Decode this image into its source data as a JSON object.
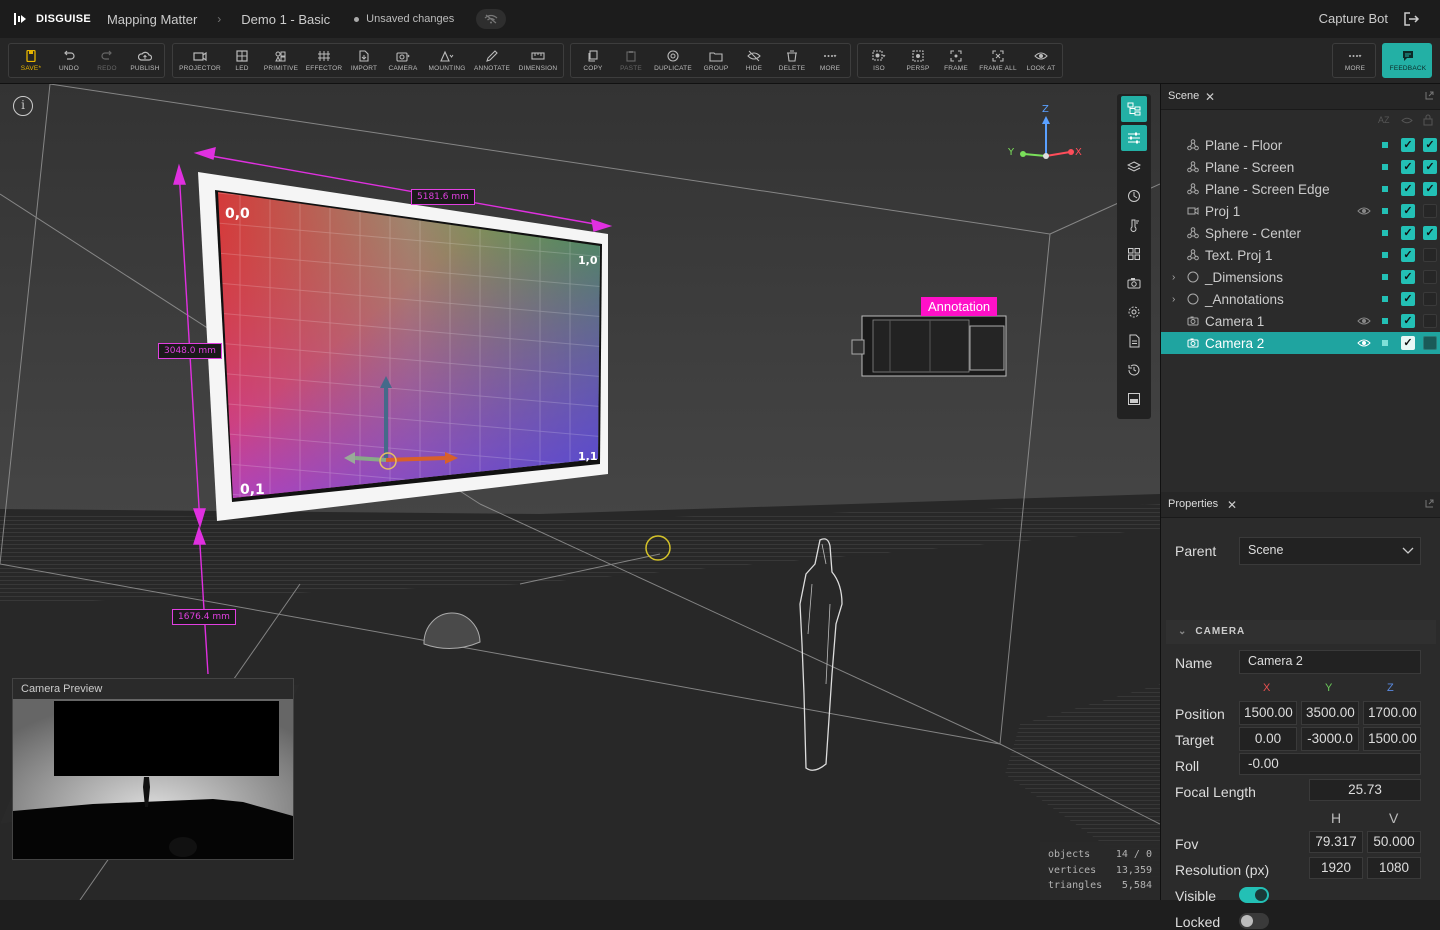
{
  "app": {
    "brand": "DISGUISE",
    "project": "Mapping Matter",
    "file": "Demo 1 - Basic",
    "status": "Unsaved changes",
    "user": "Capture Bot"
  },
  "toolbar": {
    "edit": [
      "SAVE*",
      "UNDO",
      "REDO",
      "PUBLISH"
    ],
    "create": [
      "PROJECTOR",
      "LED",
      "PRIMITIVE",
      "EFFECTOR",
      "IMPORT",
      "CAMERA",
      "MOUNTING",
      "ANNOTATE",
      "DIMENSION"
    ],
    "modify": [
      "COPY",
      "PASTE",
      "DUPLICATE",
      "GROUP",
      "HIDE",
      "DELETE",
      "MORE"
    ],
    "view": [
      "ISO",
      "PERSP",
      "FRAME",
      "FRAME ALL",
      "LOOK AT"
    ],
    "right": [
      "MORE",
      "FEEDBACK"
    ]
  },
  "viewport": {
    "dimensions": [
      "5181.6 mm",
      "3048.0 mm",
      "1676.4 mm"
    ],
    "annotation": "Annotation",
    "axes": {
      "x": "X",
      "y": "Y",
      "z": "Z"
    },
    "screen_corners": [
      "0,0",
      "1,0",
      "0,1",
      "1,1"
    ],
    "camera_preview_title": "Camera Preview",
    "stats": [
      {
        "label": "objects",
        "value": "14 / 0"
      },
      {
        "label": "vertices",
        "value": "13,359"
      },
      {
        "label": "triangles",
        "value": "5,584"
      }
    ]
  },
  "scene": {
    "title": "Scene",
    "sort_label": "AZ",
    "items": [
      {
        "label": "Plane - Floor",
        "icon": "mesh-icon",
        "eye": false,
        "locked": true,
        "caret": false
      },
      {
        "label": "Plane - Screen",
        "icon": "mesh-icon",
        "eye": false,
        "locked": true,
        "caret": false
      },
      {
        "label": "Plane - Screen Edge",
        "icon": "mesh-icon",
        "eye": false,
        "locked": true,
        "caret": false
      },
      {
        "label": "Proj 1",
        "icon": "projector-icon",
        "eye": true,
        "locked": false,
        "caret": false
      },
      {
        "label": "Sphere - Center",
        "icon": "mesh-icon",
        "eye": false,
        "locked": true,
        "caret": false
      },
      {
        "label": "Text. Proj 1",
        "icon": "mesh-icon",
        "eye": false,
        "locked": false,
        "caret": false
      },
      {
        "label": "_Dimensions",
        "icon": "group-icon",
        "eye": false,
        "locked": false,
        "caret": true
      },
      {
        "label": "_Annotations",
        "icon": "group-icon",
        "eye": false,
        "locked": false,
        "caret": true
      },
      {
        "label": "Camera 1",
        "icon": "camera-icon",
        "eye": true,
        "locked": false,
        "caret": false
      },
      {
        "label": "Camera 2",
        "icon": "camera-icon",
        "eye": true,
        "locked": false,
        "caret": false,
        "selected": true
      }
    ]
  },
  "properties": {
    "title": "Properties",
    "parent_label": "Parent",
    "parent_value": "Scene",
    "section": "CAMERA",
    "name_label": "Name",
    "name_value": "Camera 2",
    "axis_x": "X",
    "axis_y": "Y",
    "axis_z": "Z",
    "position_label": "Position",
    "position": [
      "1500.00",
      "3500.00",
      "1700.00"
    ],
    "target_label": "Target",
    "target": [
      "0.00",
      "-3000.0",
      "1500.00"
    ],
    "roll_label": "Roll",
    "roll": "-0.00",
    "focal_label": "Focal Length",
    "focal": "25.73",
    "h_label": "H",
    "v_label": "V",
    "fov_label": "Fov",
    "fov": [
      "79.317",
      "50.000"
    ],
    "res_label": "Resolution (px)",
    "res": [
      "1920",
      "1080"
    ],
    "visible_label": "Visible",
    "visible": true,
    "locked_label": "Locked",
    "locked": false
  },
  "colors": {
    "accent": "#23c0b5",
    "magenta": "#ff10c8",
    "selected": "#1fa4a0"
  }
}
